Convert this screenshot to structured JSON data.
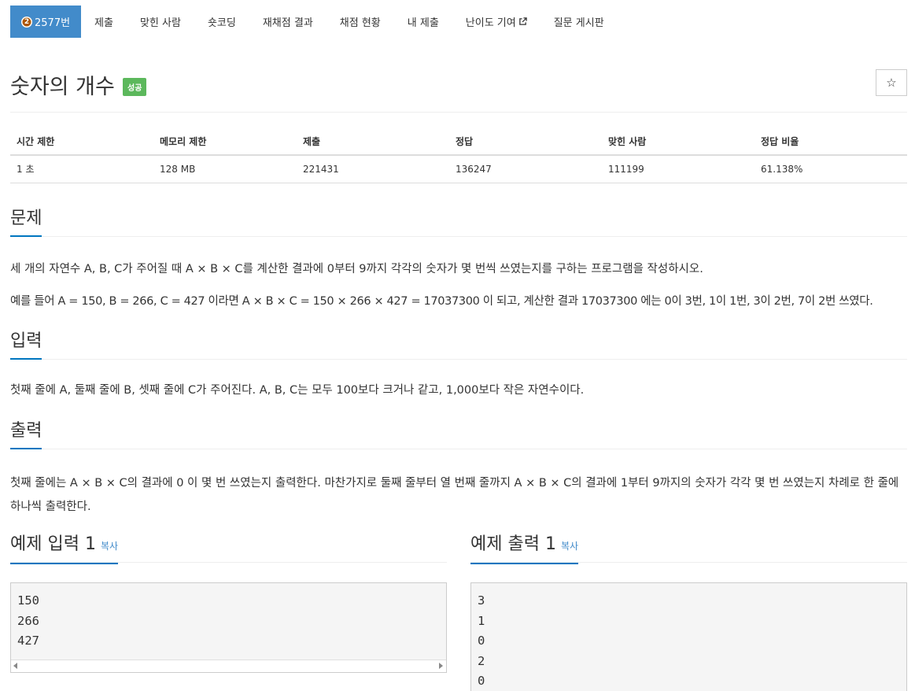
{
  "nav": {
    "tabs": [
      {
        "label": "2577번",
        "tier": "2"
      },
      {
        "label": "제출"
      },
      {
        "label": "맞힌 사람"
      },
      {
        "label": "숏코딩"
      },
      {
        "label": "재채점 결과"
      },
      {
        "label": "채점 현황"
      },
      {
        "label": "내 제출"
      },
      {
        "label": "난이도 기여"
      },
      {
        "label": "질문 게시판"
      }
    ]
  },
  "problem": {
    "title": "숫자의 개수",
    "status_badge": "성공",
    "star": "☆"
  },
  "info": {
    "headers": [
      "시간 제한",
      "메모리 제한",
      "제출",
      "정답",
      "맞힌 사람",
      "정답 비율"
    ],
    "values": [
      "1 초",
      "128 MB",
      "221431",
      "136247",
      "111199",
      "61.138%"
    ]
  },
  "sections": {
    "problem_title": "문제",
    "problem_p1": "세 개의 자연수 A, B, C가 주어질 때 A × B × C를 계산한 결과에 0부터 9까지 각각의 숫자가 몇 번씩 쓰였는지를 구하는 프로그램을 작성하시오.",
    "problem_p2": "예를 들어 A = 150, B = 266, C = 427 이라면 A × B × C = 150 × 266 × 427 = 17037300 이 되고, 계산한 결과 17037300 에는 0이 3번, 1이 1번, 3이 2번, 7이 2번 쓰였다.",
    "input_title": "입력",
    "input_p": "첫째 줄에 A, 둘째 줄에 B, 셋째 줄에 C가 주어진다. A, B, C는 모두 100보다 크거나 같고, 1,000보다 작은 자연수이다.",
    "output_title": "출력",
    "output_p": "첫째 줄에는 A × B × C의 결과에 0 이 몇 번 쓰였는지 출력한다. 마찬가지로 둘째 줄부터 열 번째 줄까지 A × B × C의 결과에 1부터 9까지의 숫자가 각각 몇 번 쓰였는지 차례로 한 줄에 하나씩 출력한다."
  },
  "samples": {
    "input_title": "예제 입력 1",
    "output_title": "예제 출력 1",
    "copy_label": "복사",
    "input_text": "150\n266\n427",
    "output_text": "3\n1\n0\n2\n0"
  },
  "colors": {
    "accent": "#428bca",
    "success": "#5cb85c",
    "section_underline": "#0076c0",
    "tier_bronze": "#ad5600"
  }
}
